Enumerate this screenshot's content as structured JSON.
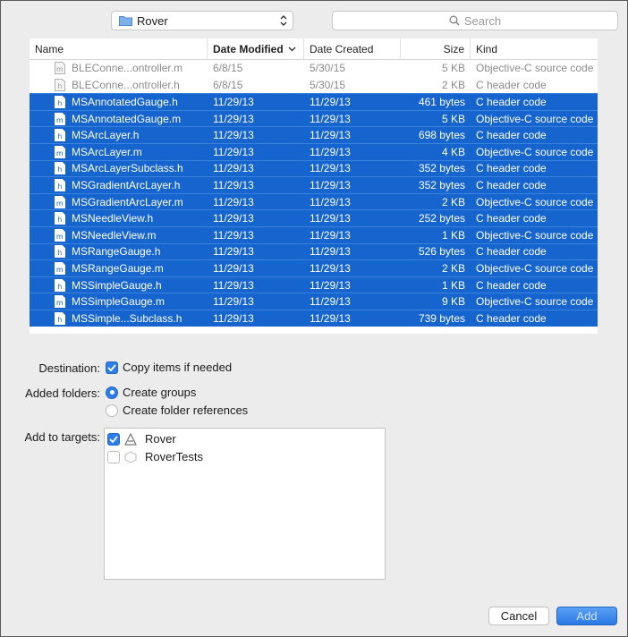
{
  "toolbar": {
    "location": "Rover",
    "search_placeholder": "Search"
  },
  "columns": {
    "name": "Name",
    "modified": "Date Modified",
    "created": "Date Created",
    "size": "Size",
    "kind": "Kind"
  },
  "files": [
    {
      "icon": "m",
      "name": "BLEConne...ontroller.m",
      "modified": "6/8/15",
      "created": "5/30/15",
      "size": "5 KB",
      "kind": "Objective-C source code",
      "selected": false
    },
    {
      "icon": "h",
      "name": "BLEConne...ontroller.h",
      "modified": "6/8/15",
      "created": "5/30/15",
      "size": "2 KB",
      "kind": "C header code",
      "selected": false
    },
    {
      "icon": "h",
      "name": "MSAnnotatedGauge.h",
      "modified": "11/29/13",
      "created": "11/29/13",
      "size": "461 bytes",
      "kind": "C header code",
      "selected": true
    },
    {
      "icon": "m",
      "name": "MSAnnotatedGauge.m",
      "modified": "11/29/13",
      "created": "11/29/13",
      "size": "5 KB",
      "kind": "Objective-C source code",
      "selected": true
    },
    {
      "icon": "h",
      "name": "MSArcLayer.h",
      "modified": "11/29/13",
      "created": "11/29/13",
      "size": "698 bytes",
      "kind": "C header code",
      "selected": true
    },
    {
      "icon": "m",
      "name": "MSArcLayer.m",
      "modified": "11/29/13",
      "created": "11/29/13",
      "size": "4 KB",
      "kind": "Objective-C source code",
      "selected": true
    },
    {
      "icon": "h",
      "name": "MSArcLayerSubclass.h",
      "modified": "11/29/13",
      "created": "11/29/13",
      "size": "352 bytes",
      "kind": "C header code",
      "selected": true
    },
    {
      "icon": "h",
      "name": "MSGradientArcLayer.h",
      "modified": "11/29/13",
      "created": "11/29/13",
      "size": "352 bytes",
      "kind": "C header code",
      "selected": true
    },
    {
      "icon": "m",
      "name": "MSGradientArcLayer.m",
      "modified": "11/29/13",
      "created": "11/29/13",
      "size": "2 KB",
      "kind": "Objective-C source code",
      "selected": true
    },
    {
      "icon": "h",
      "name": "MSNeedleView.h",
      "modified": "11/29/13",
      "created": "11/29/13",
      "size": "252 bytes",
      "kind": "C header code",
      "selected": true
    },
    {
      "icon": "m",
      "name": "MSNeedleView.m",
      "modified": "11/29/13",
      "created": "11/29/13",
      "size": "1 KB",
      "kind": "Objective-C source code",
      "selected": true
    },
    {
      "icon": "h",
      "name": "MSRangeGauge.h",
      "modified": "11/29/13",
      "created": "11/29/13",
      "size": "526 bytes",
      "kind": "C header code",
      "selected": true
    },
    {
      "icon": "m",
      "name": "MSRangeGauge.m",
      "modified": "11/29/13",
      "created": "11/29/13",
      "size": "2 KB",
      "kind": "Objective-C source code",
      "selected": true
    },
    {
      "icon": "h",
      "name": "MSSimpleGauge.h",
      "modified": "11/29/13",
      "created": "11/29/13",
      "size": "1 KB",
      "kind": "C header code",
      "selected": true
    },
    {
      "icon": "m",
      "name": "MSSimpleGauge.m",
      "modified": "11/29/13",
      "created": "11/29/13",
      "size": "9 KB",
      "kind": "Objective-C source code",
      "selected": true
    },
    {
      "icon": "h",
      "name": "MSSimple...Subclass.h",
      "modified": "11/29/13",
      "created": "11/29/13",
      "size": "739 bytes",
      "kind": "C header code",
      "selected": true
    }
  ],
  "options": {
    "destination_label": "Destination:",
    "copy_items_label": "Copy items if needed",
    "copy_items_checked": true,
    "added_folders_label": "Added folders:",
    "create_groups_label": "Create groups",
    "create_groups_selected": true,
    "folder_refs_label": "Create folder references",
    "folder_refs_selected": false,
    "targets_label": "Add to targets:",
    "targets": [
      {
        "name": "Rover",
        "checked": true
      },
      {
        "name": "RoverTests",
        "checked": false
      }
    ]
  },
  "buttons": {
    "cancel": "Cancel",
    "add": "Add"
  },
  "colors": {
    "selection": "#1665cf",
    "accent": "#2b7de9"
  }
}
